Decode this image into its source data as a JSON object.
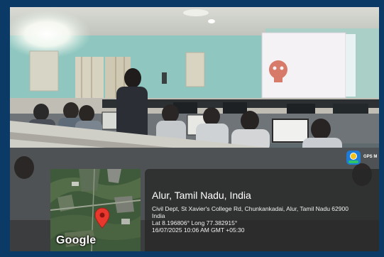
{
  "photo": {
    "description_icon": "classroom-photo"
  },
  "gps_overlay": {
    "map_attribution": "Google",
    "map_marker_icon": "map-pin-icon",
    "location_title": "Alur, Tamil Nadu, India",
    "address_line": "Civil Dept, St Xavier's College Rd, Chunkankadai, Alur, Tamil Nadu 62900",
    "country_line": "India",
    "coordinates_line": "Lat 8.196806° Long 77.382915°",
    "timestamp_line": "16/07/2025 10:06 AM GMT +05:30",
    "app_label": "GPS M",
    "colors": {
      "panel_bg": "#282828",
      "pin": "#e8382e",
      "frame_border": "#0b3a66"
    }
  }
}
